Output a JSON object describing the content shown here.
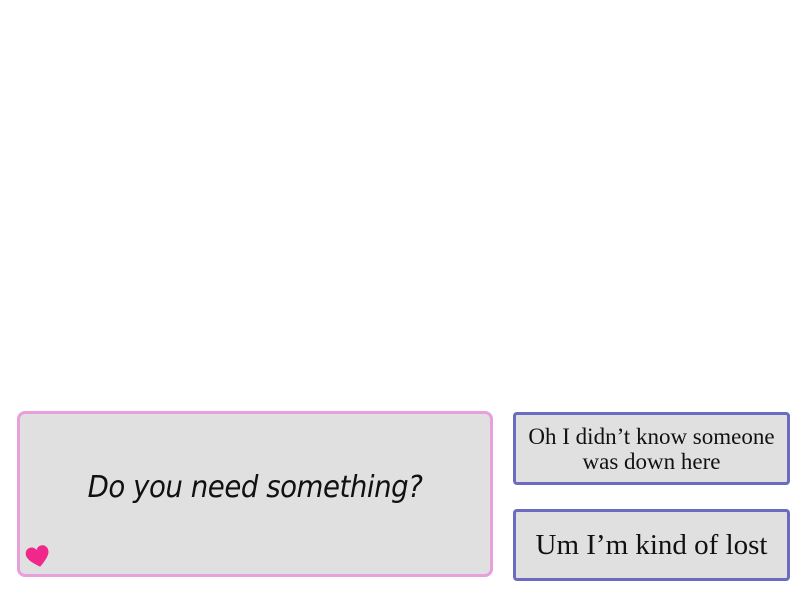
{
  "dialogue": {
    "text": "Do you need something?",
    "indicator_icon": "heart-icon",
    "border_color": "#e8a0dc",
    "indicator_color": "#f0288c"
  },
  "choices": [
    {
      "label": "Oh I didn’t know someone was down here"
    },
    {
      "label": "Um I’m kind of lost"
    }
  ],
  "colors": {
    "panel_bg": "#e0e0e0",
    "choice_border": "#6b6bbf"
  }
}
